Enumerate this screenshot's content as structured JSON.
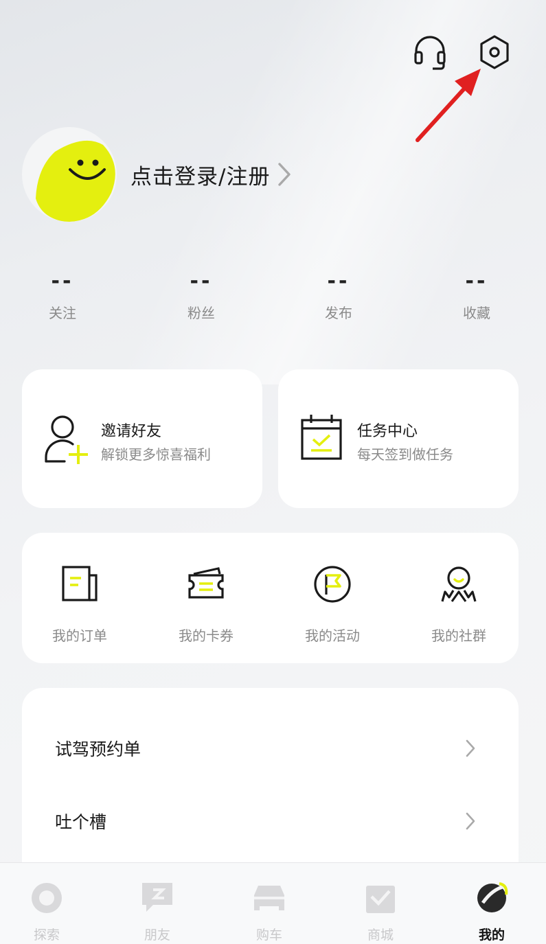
{
  "header": {
    "service_icon": "headset-icon",
    "settings_icon": "hex-gear-icon"
  },
  "profile": {
    "login_label": "点击登录/注册"
  },
  "stats": [
    {
      "value": "--",
      "label": "关注"
    },
    {
      "value": "--",
      "label": "粉丝"
    },
    {
      "value": "--",
      "label": "发布"
    },
    {
      "value": "--",
      "label": "收藏"
    }
  ],
  "cards": {
    "invite": {
      "title": "邀请好友",
      "subtitle": "解锁更多惊喜福利"
    },
    "task": {
      "title": "任务中心",
      "subtitle": "每天签到做任务"
    }
  },
  "shortcuts": [
    {
      "label": "我的订单",
      "icon": "order-icon"
    },
    {
      "label": "我的卡券",
      "icon": "coupon-icon"
    },
    {
      "label": "我的活动",
      "icon": "flag-icon"
    },
    {
      "label": "我的社群",
      "icon": "community-icon"
    }
  ],
  "list": [
    {
      "label": "试驾预约单"
    },
    {
      "label": "吐个槽"
    }
  ],
  "tabbar": {
    "active": "我的",
    "tabs": [
      {
        "label": "探索",
        "icon": "explore-icon"
      },
      {
        "label": "朋友",
        "icon": "friends-icon"
      },
      {
        "label": "购车",
        "icon": "car-icon"
      },
      {
        "label": "商城",
        "icon": "store-icon"
      },
      {
        "label": "我的",
        "icon": "profile-icon"
      }
    ]
  },
  "colors": {
    "accent": "#e4ef0f",
    "annotation_arrow": "#e02020",
    "muted_text": "#8a8a8a"
  }
}
